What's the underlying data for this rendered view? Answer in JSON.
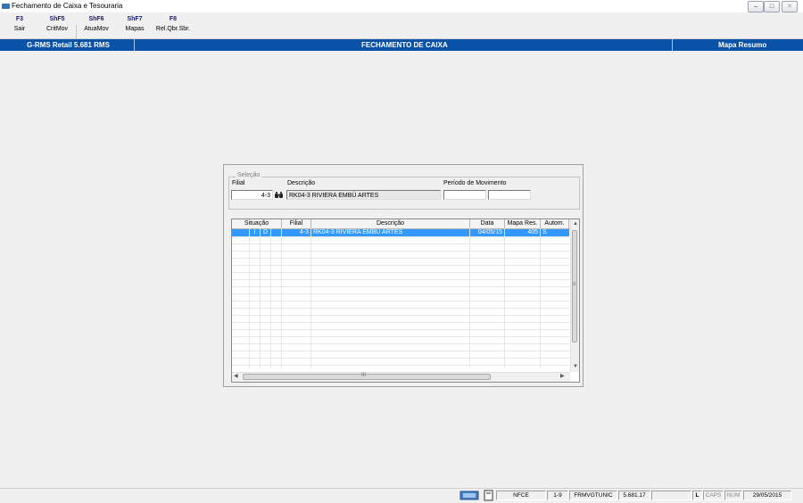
{
  "window": {
    "title": "Fechamento de Caixa e Tesouraria"
  },
  "toolbar": {
    "buttons": [
      {
        "key": "F3",
        "label": "Sair"
      },
      {
        "key": "ShF5",
        "label": "CritMov"
      },
      {
        "key": "ShF6",
        "label": "AtuaMov"
      },
      {
        "key": "ShF7",
        "label": "Mapas"
      },
      {
        "key": "F8",
        "label": "Rel.Qbr.Sbr."
      }
    ]
  },
  "header": {
    "product": "G-RMS Retail 5.681 RMS",
    "screen_title": "FECHAMENTO DE CAIXA",
    "section": "Mapa Resumo"
  },
  "selection": {
    "legend": "Seleção",
    "filial_label": "Filial",
    "filial_value": "4-3",
    "descricao_label": "Descrição",
    "descricao_value": "RK04-3 RIVIERA EMBÚ ARTES",
    "periodo_label": "Período de Movimento",
    "periodo_start": "",
    "periodo_end": ""
  },
  "grid": {
    "columns": [
      "Situação",
      "Filial",
      "Descrição",
      "Data",
      "Mapa Res.",
      "Autom."
    ],
    "rows": [
      {
        "sit1": "I",
        "sit2": "D",
        "sit3": "",
        "filial": "4-3",
        "descricao": "RK04-3 RIVIERA EMBÚ ARTES",
        "data": "04/05/15",
        "mapa": "405",
        "autom": "S"
      }
    ],
    "scroll_mid": "≡",
    "hscroll_mid": "III"
  },
  "status": {
    "items": [
      "NFCE",
      "1-9",
      "FRMVGTUNIC",
      "5.681.17",
      "",
      "L",
      "CAPS",
      "NUM",
      "29/05/2015"
    ]
  },
  "colors": {
    "header_bar": "#0a52a8",
    "selection": "#3399ff"
  }
}
